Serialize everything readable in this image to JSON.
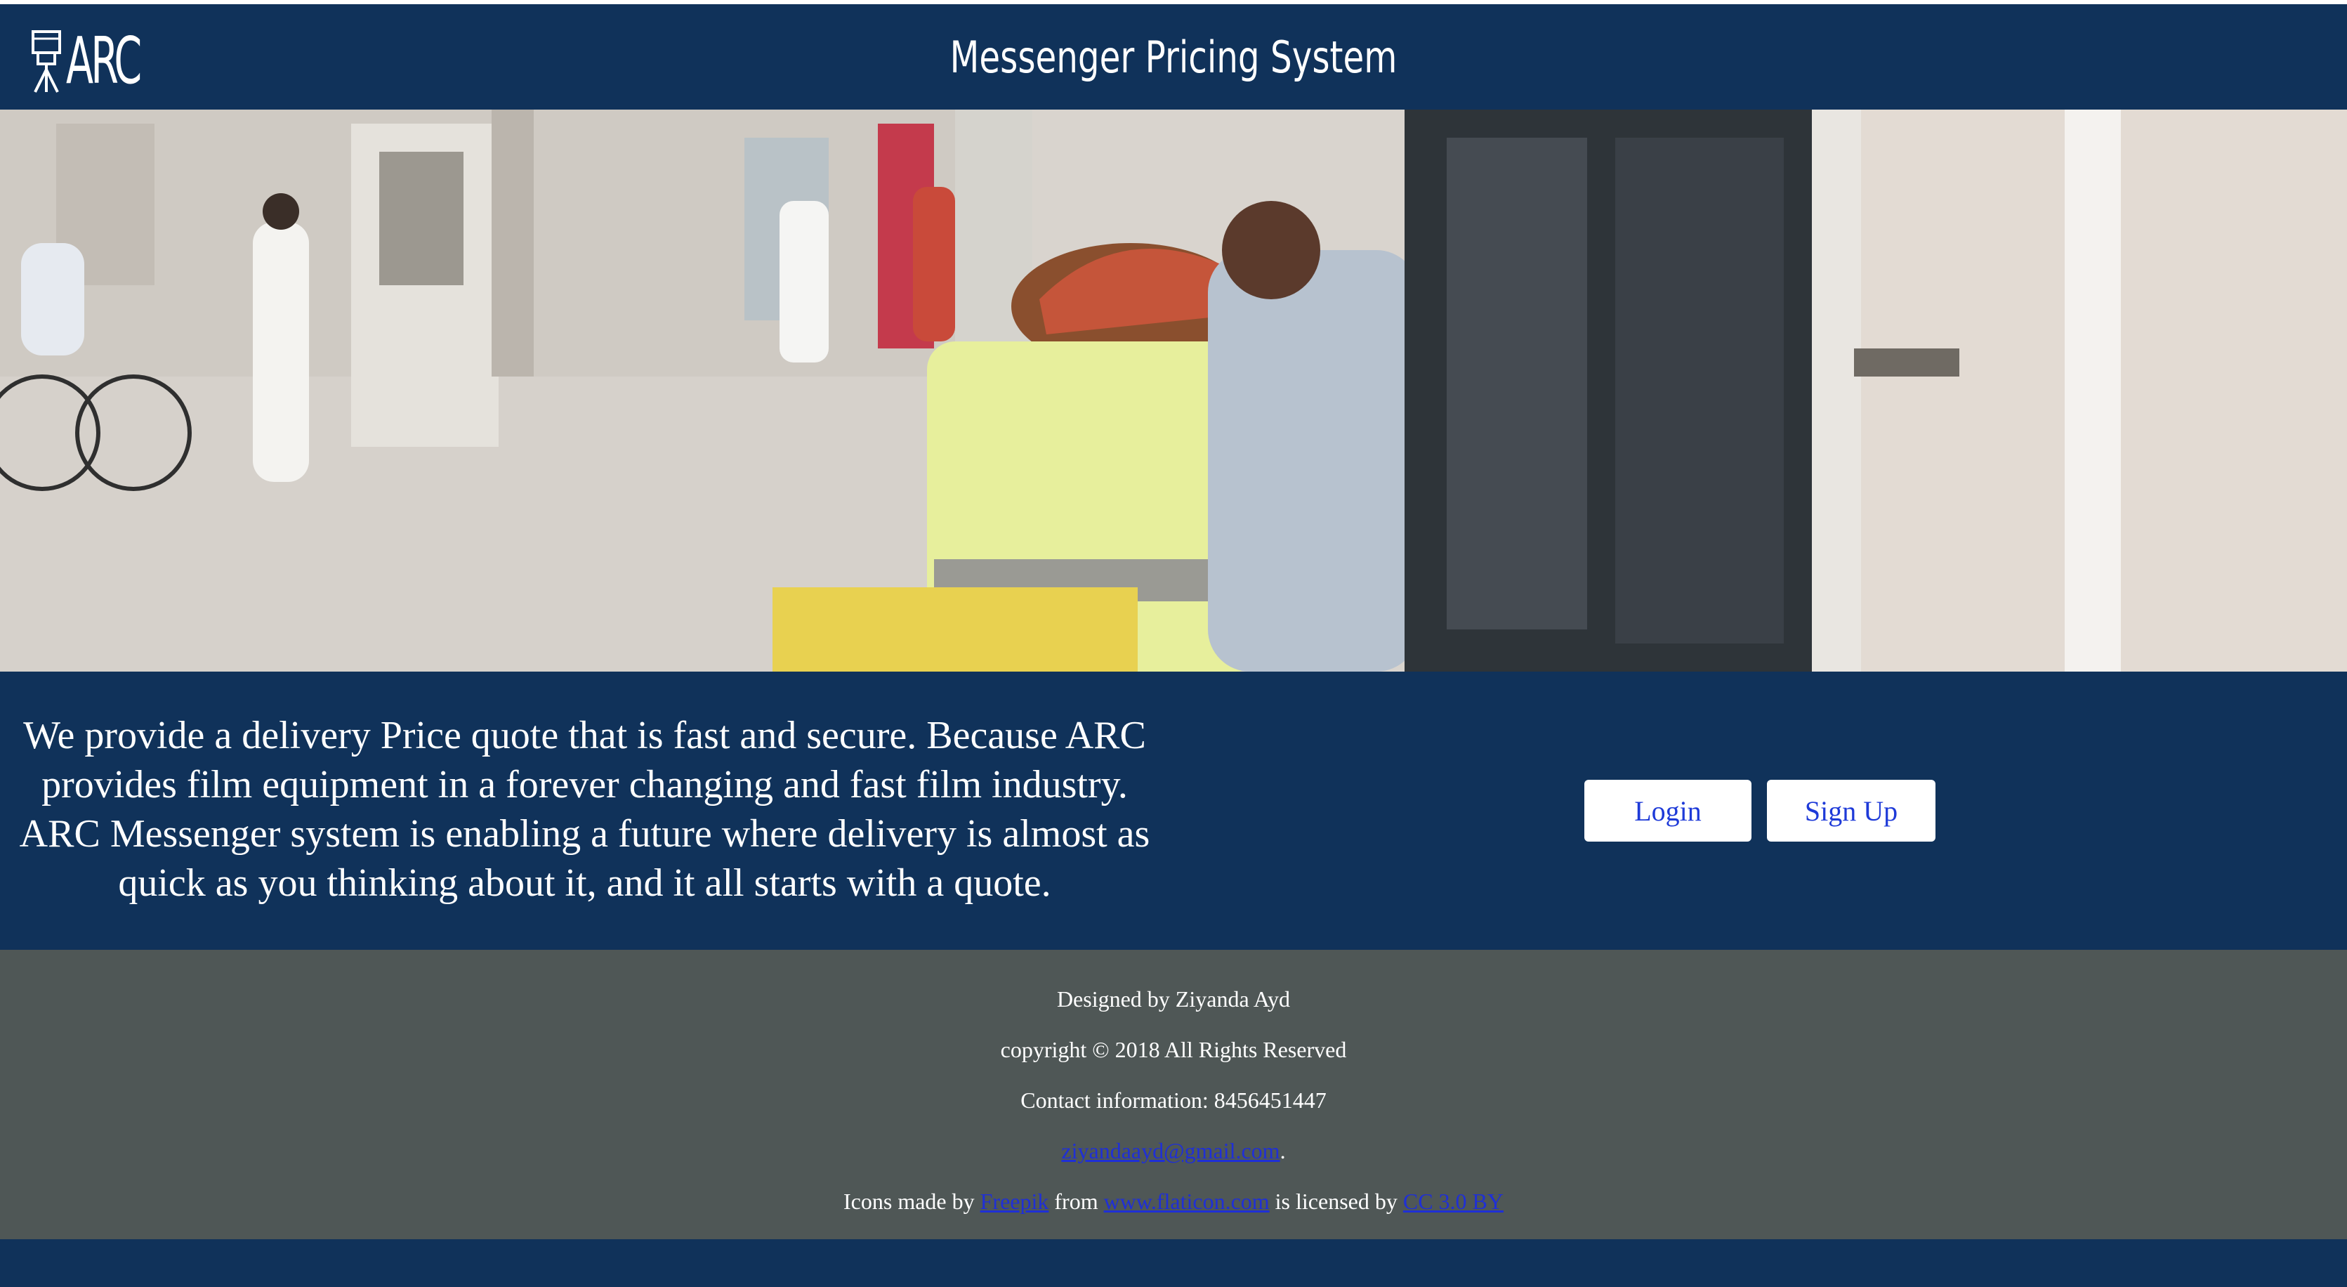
{
  "header": {
    "logo_text": "ARC",
    "logo_icon": "film-camera-icon",
    "title": "Messenger Pricing System"
  },
  "hero": {
    "image": "street-delivery-messenger-photo"
  },
  "main": {
    "tagline": "We provide a delivery Price quote that is fast and secure. Because ARC provides film equipment in a forever changing and fast film industry. ARC Messenger system is enabling a future where delivery is almost as quick as you thinking about it, and it all starts with a quote.",
    "login_label": "Login",
    "signup_label": "Sign Up"
  },
  "footer": {
    "designed_by": "Designed by Ziyanda Ayd",
    "copyright": "copyright © 2018 All Rights Reserved",
    "contact": "Contact information: 8456451447",
    "email": "ziyandaayd@gmail.com",
    "email_suffix": ".",
    "icons_prefix": "Icons made by",
    "icons_author": "Freepik",
    "icons_from": "from",
    "icons_site": "www.flaticon.com",
    "icons_licensed": "is licensed by",
    "icons_license": "CC 3.0 BY"
  },
  "colors": {
    "navy": "#10325a",
    "footer_gray": "#4f5756",
    "link_blue": "#1f2fd6",
    "button_text": "#1e3ad8"
  }
}
